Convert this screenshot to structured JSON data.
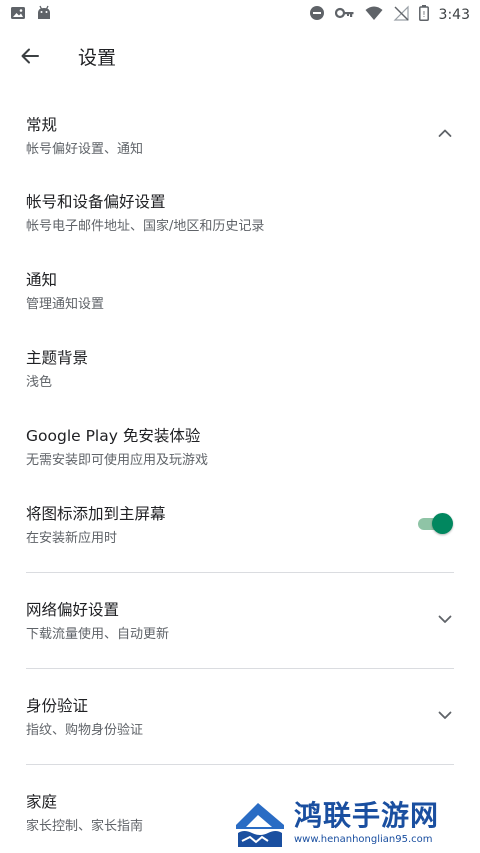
{
  "status_bar": {
    "time": "3:43",
    "left_icons": [
      "image-icon",
      "android-icon"
    ],
    "right_icons": [
      "do-not-disturb-icon",
      "vpn-key-icon",
      "wifi-icon",
      "no-signal-icon",
      "battery-icon"
    ]
  },
  "app_bar": {
    "back_icon": "arrow-back-icon",
    "title": "设置"
  },
  "settings": {
    "general": {
      "title": "常规",
      "subtitle": "帐号偏好设置、通知",
      "expanded": true
    },
    "account": {
      "title": "帐号和设备偏好设置",
      "subtitle": "帐号电子邮件地址、国家/地区和历史记录"
    },
    "notifications": {
      "title": "通知",
      "subtitle": "管理通知设置"
    },
    "theme": {
      "title": "主题背景",
      "subtitle": "浅色"
    },
    "instant": {
      "title": "Google Play 免安装体验",
      "subtitle": "无需安装即可使用应用及玩游戏"
    },
    "add_icon": {
      "title": "将图标添加到主屏幕",
      "subtitle": "在安装新应用时",
      "enabled": true
    },
    "network": {
      "title": "网络偏好设置",
      "subtitle": "下载流量使用、自动更新",
      "expanded": false
    },
    "auth": {
      "title": "身份验证",
      "subtitle": "指纹、购物身份验证",
      "expanded": false
    },
    "family": {
      "title": "家庭",
      "subtitle": "家长控制、家长指南"
    }
  },
  "colors": {
    "accent": "#01875f",
    "divider": "#dadce0",
    "watermark": "#1a4fa0"
  },
  "watermark": {
    "title": "鸿联手游网",
    "url": "www.henanhonglian95.com"
  }
}
